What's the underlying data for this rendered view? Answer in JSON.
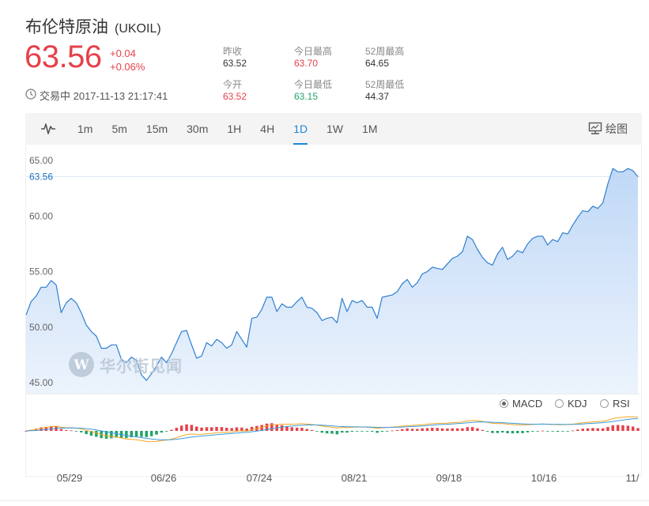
{
  "header": {
    "name": "布伦特原油",
    "symbol": "(UKOIL)",
    "price": "63.56",
    "change_abs": "+0.04",
    "change_pct": "+0.06%",
    "status": "交易中 2017-11-13 21:17:41"
  },
  "stats": [
    {
      "label": "昨收",
      "value": "63.52",
      "tone": "neutral"
    },
    {
      "label": "今日最高",
      "value": "63.70",
      "tone": "red"
    },
    {
      "label": "52周最高",
      "value": "64.65",
      "tone": "neutral"
    },
    {
      "label": "今开",
      "value": "63.52",
      "tone": "red"
    },
    {
      "label": "今日最低",
      "value": "63.15",
      "tone": "green"
    },
    {
      "label": "52周最低",
      "value": "44.37",
      "tone": "neutral"
    }
  ],
  "toolbar": {
    "tabs": [
      "1m",
      "5m",
      "15m",
      "30m",
      "1H",
      "4H",
      "1D",
      "1W",
      "1M"
    ],
    "active_tab": "1D",
    "draw_label": "绘图",
    "icons": {
      "chart_type": "waveform-icon",
      "draw": "drawing-board-icon",
      "clock": "clock-icon"
    }
  },
  "indicators": {
    "options": [
      "MACD",
      "KDJ",
      "RSI"
    ],
    "selected": "MACD"
  },
  "watermark": {
    "text": "华尔街见闻",
    "logo_letter": "W"
  },
  "colors": {
    "up": "#e6414a",
    "down": "#23a36a",
    "accent": "#1e87d7",
    "area": "#cfe2f8"
  },
  "chart_data": {
    "type": "area",
    "y_ticks": [
      "65.00",
      "60.00",
      "55.00",
      "50.00",
      "45.00"
    ],
    "ylim": [
      44.0,
      66.3
    ],
    "last_price_label": "63.56",
    "last_price": 63.56,
    "x_ticks": [
      "05/29",
      "06/26",
      "07/24",
      "08/21",
      "09/18",
      "10/16",
      "11/"
    ],
    "close": [
      51.1,
      52.3,
      52.8,
      53.6,
      53.6,
      54.2,
      53.8,
      51.3,
      52.2,
      52.6,
      52.2,
      51.3,
      50.2,
      49.6,
      49.2,
      48.1,
      48.1,
      48.4,
      48.4,
      47.1,
      46.8,
      47.3,
      47.0,
      45.7,
      45.2,
      45.8,
      46.5,
      47.3,
      46.8,
      47.6,
      48.6,
      49.6,
      49.7,
      48.4,
      47.2,
      47.4,
      48.6,
      48.3,
      48.9,
      48.6,
      48.1,
      48.4,
      49.6,
      48.9,
      48.2,
      50.8,
      50.9,
      51.6,
      52.7,
      52.7,
      51.4,
      52.1,
      51.8,
      51.8,
      52.3,
      52.7,
      51.8,
      51.7,
      51.3,
      50.6,
      50.8,
      50.9,
      50.4,
      52.6,
      51.4,
      52.4,
      52.2,
      52.4,
      51.8,
      51.8,
      50.8,
      52.7,
      52.8,
      52.9,
      53.2,
      53.9,
      54.3,
      53.6,
      54.0,
      54.8,
      55.0,
      55.4,
      55.3,
      55.2,
      55.7,
      56.2,
      56.4,
      56.8,
      58.2,
      57.9,
      57.0,
      56.3,
      55.8,
      55.6,
      56.6,
      57.2,
      56.1,
      56.4,
      56.9,
      56.7,
      57.5,
      58.0,
      58.2,
      58.2,
      57.4,
      57.9,
      57.7,
      58.5,
      58.4,
      59.2,
      59.9,
      60.5,
      60.4,
      60.9,
      60.7,
      61.2,
      62.9,
      64.3,
      64.0,
      64.0,
      64.3,
      64.1,
      63.56
    ]
  }
}
